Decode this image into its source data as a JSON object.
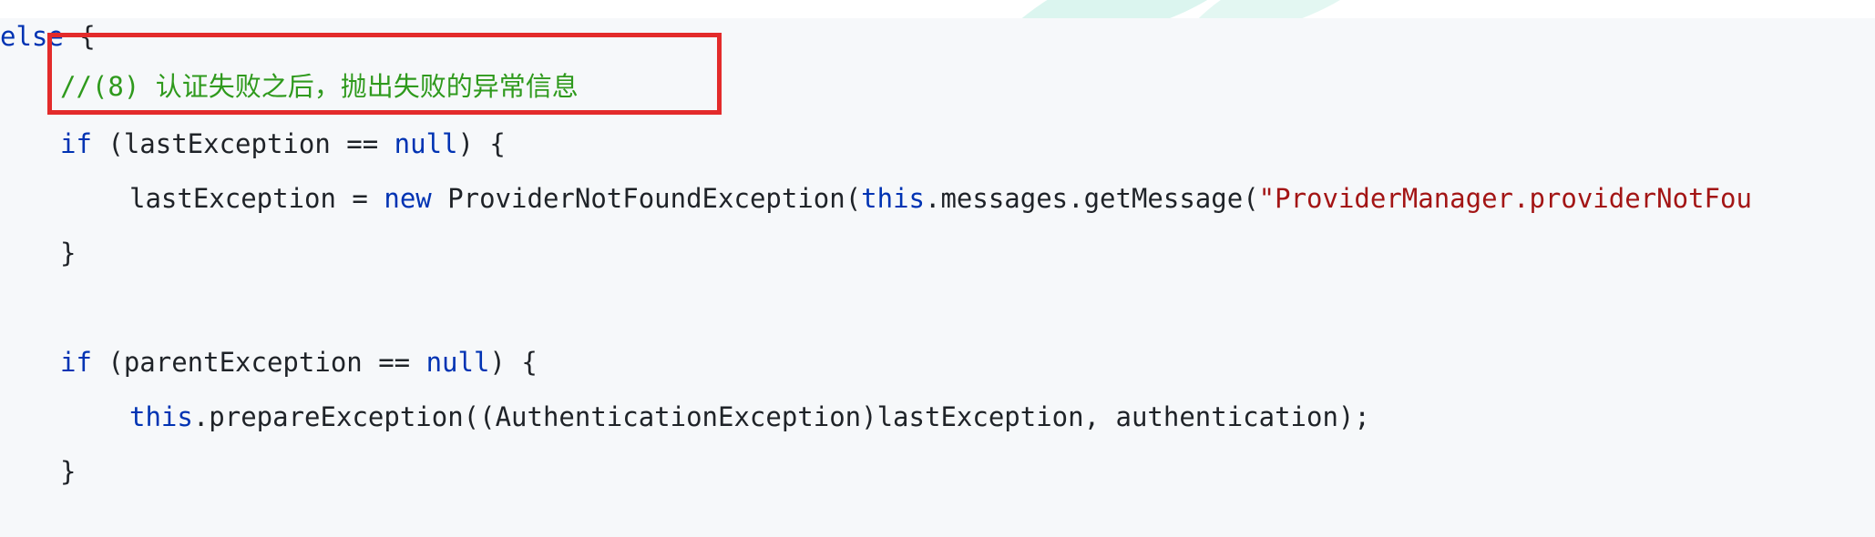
{
  "colors": {
    "keyword": "#0033b3",
    "string": "#a31515",
    "comment": "#2f9a1d",
    "plain": "#1f2328",
    "highlight_box": "#e32b2b",
    "background": "#f6f8fa",
    "watermark": "#7fd6c4"
  },
  "watermark": {
    "icon": "leaf-watermark"
  },
  "code": {
    "line0": {
      "indent": "",
      "kw": "else",
      "rest": " {"
    },
    "line1": {
      "comment": "//(8) 认证失败之后，抛出失败的异常信息"
    },
    "line2": {
      "kw_if": "if",
      "part1": " (lastException == ",
      "kw_null": "null",
      "part2": ") {"
    },
    "line3": {
      "part1": "lastException = ",
      "kw_new": "new",
      "part2": " ProviderNotFoundException(",
      "kw_this": "this",
      "part3": ".messages.getMessage(",
      "string": "\"ProviderManager.providerNotFou"
    },
    "line4": {
      "text": "}"
    },
    "line6": {
      "kw_if": "if",
      "part1": " (parentException == ",
      "kw_null": "null",
      "part2": ") {"
    },
    "line7": {
      "kw_this": "this",
      "part1": ".prepareException((AuthenticationException)lastException, authentication);"
    },
    "line8": {
      "text": "}"
    }
  }
}
